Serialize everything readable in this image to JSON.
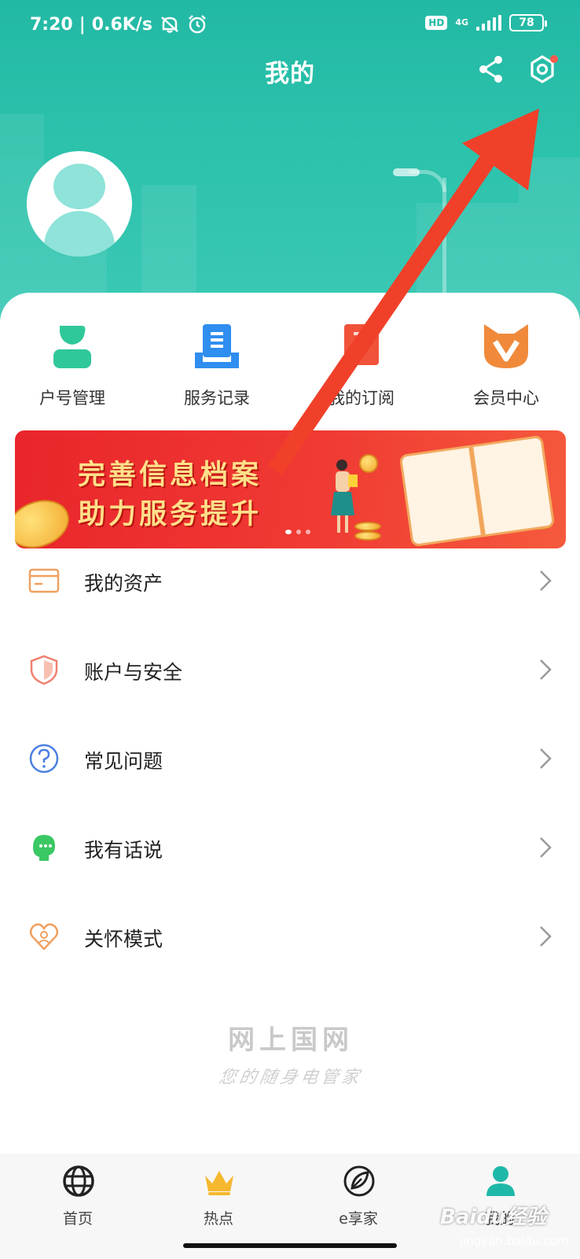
{
  "status_bar": {
    "time": "7:20",
    "network_speed": "0.6K/s",
    "hd_badge": "HD",
    "network_type": "4G",
    "battery": "78"
  },
  "header": {
    "title": "我的",
    "share_icon": "share-icon",
    "settings_icon": "settings-icon"
  },
  "quick_actions": [
    {
      "label": "户号管理",
      "icon": "account-number-icon",
      "color": "#2fc89a"
    },
    {
      "label": "服务记录",
      "icon": "service-record-icon",
      "color": "#2f8ef0"
    },
    {
      "label": "我的订阅",
      "icon": "subscription-icon",
      "color": "#f0523a"
    },
    {
      "label": "会员中心",
      "icon": "member-center-icon",
      "color": "#f08a3a"
    }
  ],
  "banner": {
    "line1": "完善信息档案",
    "line2": "助力服务提升",
    "page_count": 3,
    "active_page": 1
  },
  "menu": [
    {
      "label": "我的资产",
      "icon": "card-icon"
    },
    {
      "label": "账户与安全",
      "icon": "shield-icon"
    },
    {
      "label": "常见问题",
      "icon": "question-icon"
    },
    {
      "label": "我有话说",
      "icon": "chat-head-icon"
    },
    {
      "label": "关怀模式",
      "icon": "heart-icon"
    }
  ],
  "brand": {
    "title": "网上国网",
    "slogan": "您的随身电管家"
  },
  "bottom_nav": [
    {
      "label": "首页",
      "icon": "globe-icon"
    },
    {
      "label": "热点",
      "icon": "crown-icon"
    },
    {
      "label": "e享家",
      "icon": "leaf-icon"
    },
    {
      "label": "我的",
      "icon": "profile-icon",
      "active": true
    }
  ],
  "watermark": {
    "text": "Baidu经验",
    "url": "jingyan.baidu.com"
  },
  "colors": {
    "header_teal": "#22b9a4",
    "banner_red": "#e9252b",
    "annotation_arrow": "#f0402a"
  }
}
